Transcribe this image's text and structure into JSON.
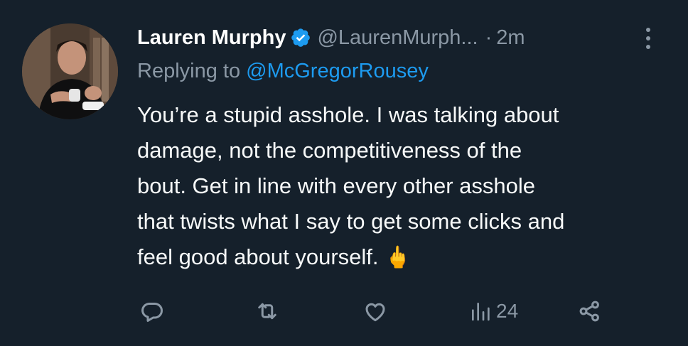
{
  "author": {
    "name": "Lauren Murphy",
    "handle": "@LaurenMurph...",
    "separator": "·",
    "time": "2m"
  },
  "reply": {
    "prefix": "Replying to ",
    "mention": "@McGregorRousey"
  },
  "tweet": {
    "text": "You’re a stupid asshole. I was talking about\ndamage, not the competitiveness of the\nbout. Get in line with every other asshole\nthat twists what I say to get some clicks and\nfeel good about yourself. ",
    "emoji": "🖕"
  },
  "actions": {
    "views_count": "24"
  },
  "icons": {
    "verified": "verified-badge-icon",
    "more": "more-options-icon",
    "reply": "reply-icon",
    "retweet": "retweet-icon",
    "like": "like-icon",
    "views": "views-icon",
    "share": "share-icon"
  },
  "colors": {
    "background": "#15202b",
    "text": "#f7f9f9",
    "muted": "#8b98a5",
    "accent": "#1d9bf0"
  }
}
